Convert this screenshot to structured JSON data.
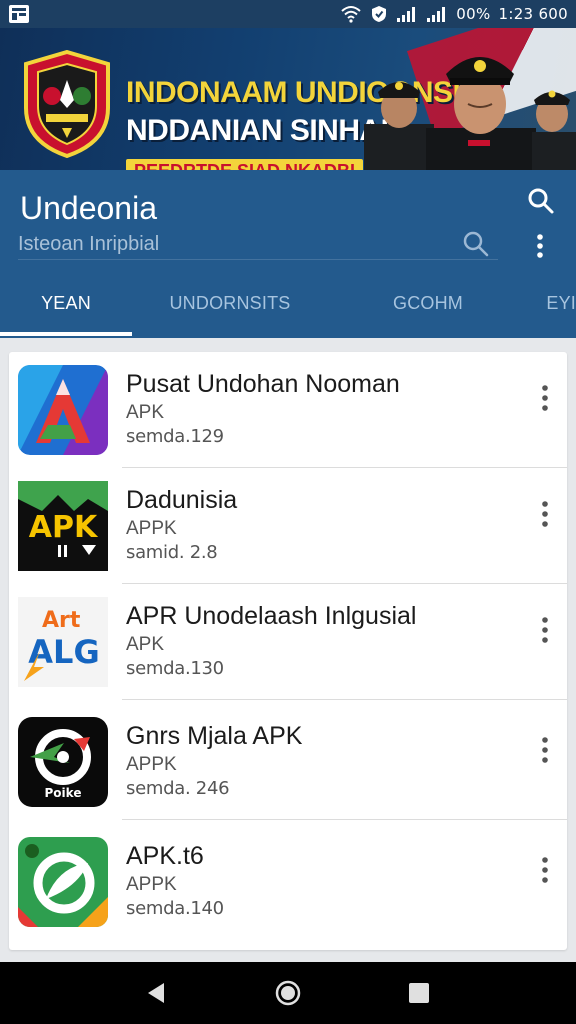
{
  "status_bar": {
    "battery": "00%",
    "time": "1:23 600",
    "icons": [
      "app-notification-icon",
      "wifi-icon",
      "shield-icon",
      "signal-icon",
      "signal-icon-2"
    ]
  },
  "banner": {
    "line1": "INDONAAM UNDIOONSIAI",
    "line2": "NDDANIAN SINHAL",
    "line3": "PEEDRTDE SIAD NKADBI"
  },
  "app": {
    "title": "Undeonia",
    "search_placeholder": "Isteoan Inripbial"
  },
  "tabs": [
    {
      "label": "YEAN",
      "active": true
    },
    {
      "label": "UNDORNSITS",
      "active": false
    },
    {
      "label": "GCOHM",
      "active": false
    },
    {
      "label": "EYI",
      "active": false
    }
  ],
  "items": [
    {
      "name": "Pusat Undohan Nooman",
      "type": "APK",
      "size": "semda.129",
      "icon": "letter-a-app-icon"
    },
    {
      "name": "Dadunisia",
      "type": "APPK",
      "size": "samid. 2.8",
      "icon": "apk-app-icon"
    },
    {
      "name": "APR Unodelaash Inlgusial",
      "type": "APK",
      "size": "semda.130",
      "icon": "alg-app-icon"
    },
    {
      "name": "Gnrs Mjala APK",
      "type": "APPK",
      "size": "semda. 246",
      "icon": "poike-app-icon"
    },
    {
      "name": "APK.t6",
      "type": "APPK",
      "size": "semda.140",
      "icon": "green-leaf-app-icon"
    }
  ],
  "logos": {
    "poike_text": "Poike",
    "apk_text": "APK",
    "alg_text": "ALG",
    "art_text": "Art"
  },
  "colors": {
    "header": "#235a8d",
    "status": "#1d3f62",
    "banner_gold": "#f3d43b",
    "banner_red": "#c8102e"
  }
}
